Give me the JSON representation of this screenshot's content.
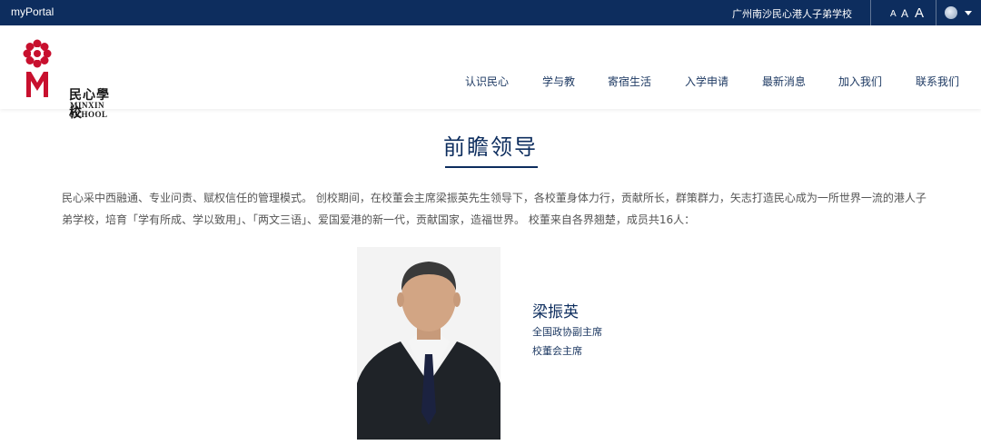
{
  "topbar": {
    "portal_label": "myPortal",
    "school_link": "广州南沙民心港人子弟学校",
    "font_sizes": [
      "A",
      "A",
      "A"
    ],
    "language_icon": "globe-icon",
    "bg_color": "#0d2d5e"
  },
  "header": {
    "logo": {
      "name_cn": "民心學校",
      "name_en": "MINXIN SCHOOL"
    },
    "nav": [
      {
        "label": "认识民心"
      },
      {
        "label": "学与教"
      },
      {
        "label": "寄宿生活"
      },
      {
        "label": "入学申请"
      },
      {
        "label": "最新消息"
      },
      {
        "label": "加入我们"
      },
      {
        "label": "联系我们"
      }
    ]
  },
  "main": {
    "title": "前瞻领导",
    "intro_line1": "民心采中西融通、专业问责、赋权信任的管理模式。 创校期间，在校董会主席梁振英先生领导下，各校董身体力行，贡献所长，群策群力，矢志打造民心成为一所世界一流的港人子",
    "intro_line2": "弟学校，培育「学有所成、学以致用」、「两文三语」、爱国爱港的新一代，贡献国家，造福世界。 校董来自各界翘楚，成员共16人：",
    "leader": {
      "name": "梁振英",
      "role1": "全国政协副主席",
      "role2": "校董会主席"
    }
  },
  "colors": {
    "accent": "#0d2d5e",
    "logo_red": "#c8102e"
  }
}
